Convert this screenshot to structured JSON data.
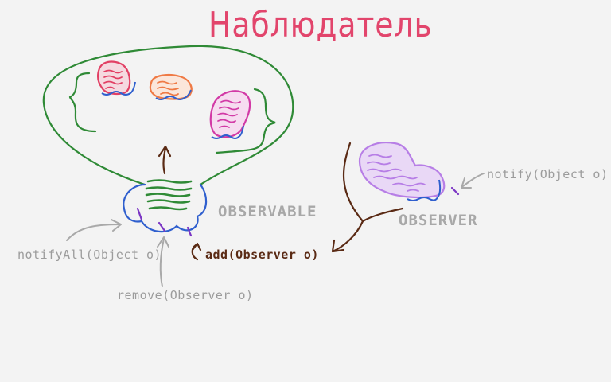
{
  "title": "Наблюдатель",
  "labels": {
    "observable": "OBSERVABLE",
    "observer": "OBSERVER",
    "notify": "notify(Object o)",
    "notify_all": "notifyAll(Object o)",
    "remove": "remove(Observer o)",
    "add": "add(Observer o)"
  },
  "colors": {
    "title": "#e2456c",
    "observable_outline": "#2f8a36",
    "observable_body": "#2f5fce",
    "observer_body": "#b77ee6",
    "observer_1": "#e23f64",
    "observer_2": "#ef7a45",
    "observer_3": "#d23aa6",
    "add_arrow": "#5a2a14",
    "annotation": "#9c9c9c"
  }
}
